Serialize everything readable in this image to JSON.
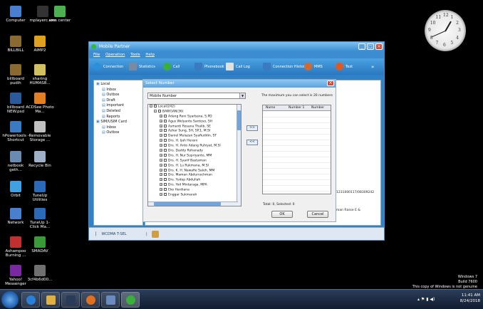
{
  "desktop_icons": [
    {
      "label": "Computer",
      "color": "#4a7fd0"
    },
    {
      "label": "mplayerc.exe",
      "color": "#333333"
    },
    {
      "label": "sms center",
      "color": "#4caf50"
    },
    {
      "label": "BILLBILL",
      "color": "#8a6a30"
    },
    {
      "label": "AIMP2",
      "color": "#e0a020"
    },
    {
      "label": "billboard pudih",
      "color": "#8a6a30"
    },
    {
      "label": "sharing HUMAS8...",
      "color": "#d0c060"
    },
    {
      "label": "billboard NEW.psd",
      "color": "#2a5a9a"
    },
    {
      "label": "ACDSee Photo Ma...",
      "color": "#e08020"
    },
    {
      "label": "hPowertools - Shortcut",
      "color": "#3a7ac0"
    },
    {
      "label": "Removable Storage ...",
      "color": "#c0c0c0"
    },
    {
      "label": "netbook geth...",
      "color": "#6a8ab0"
    },
    {
      "label": "Recycle Bin",
      "color": "#a0b0c8"
    },
    {
      "label": "Orbit",
      "color": "#40a0e0"
    },
    {
      "label": "TuneUp Utilities",
      "color": "#2a6ab8"
    },
    {
      "label": "Network",
      "color": "#4a7fd0"
    },
    {
      "label": "TuneUp 1-Click Ma...",
      "color": "#2a6ab8"
    },
    {
      "label": "Ashampoo Burning ...",
      "color": "#c03030"
    },
    {
      "label": "SMADAV",
      "color": "#3a9a3a"
    },
    {
      "label": "Yahoo! Messenger",
      "color": "#7a2aa0"
    },
    {
      "label": "3cf4b6d00...",
      "color": "#707070"
    }
  ],
  "clock": {
    "numbers": [
      "12",
      "1",
      "2",
      "3",
      "4",
      "5",
      "6",
      "7",
      "8",
      "9",
      "10",
      "11"
    ]
  },
  "app": {
    "title": "Mobile Partner",
    "menu": [
      "File",
      "Operation",
      "Tools",
      "Help"
    ],
    "toolbar": [
      {
        "label": "Connection",
        "color": "#2a90d8"
      },
      {
        "label": "Statistics",
        "color": "#7a8aa0"
      },
      {
        "label": "Call",
        "color": "#3ab03a"
      },
      {
        "label": "Phonebook",
        "color": "#3a7ac0"
      },
      {
        "label": "Call Log",
        "color": "#e0e0e0"
      },
      {
        "label": "Connection History",
        "color": "#3a7ac0"
      },
      {
        "label": "MMS",
        "color": "#d06a30"
      },
      {
        "label": "Text",
        "color": "#e05a20"
      }
    ],
    "toolbar_more": "»",
    "left_tree": {
      "root": "Local",
      "items": [
        "Inbox",
        "Outbox",
        "Draft",
        "Important",
        "Deleted",
        "Reports"
      ],
      "root2": "SIM/USIM Card",
      "items2": [
        "Inbox",
        "Outbox"
      ]
    },
    "right_text_1": "1231000117/08309242",
    "right_text_2": "man Rasse E &",
    "status": "WCDMA  T-SEL"
  },
  "dialog": {
    "title": "Select Number",
    "combo_value": "Mobile Number",
    "max_label": "The maximum you can select is 20 numbers",
    "root_label": "Local(242)",
    "group_label": "BAWGAN(36)",
    "contacts": [
      "Adang Roni Syarbana, S.PD",
      "Agus Welyanto Santoso, SH",
      "Asmanti Rosana Thalib, SE",
      "Azhar Sung, SH, SP.1, M.SI",
      "Daniel Mulazan Syafiuddin, ST",
      "Drs. H. Ijah Herani",
      "Drs. H. Anto Adang Ruhiyat, M.SI",
      "Drs. Daddy Rohanady",
      "Drs. H. Nur Supriyanto, MM",
      "Drs. H. Syarif Bastaman",
      "Drs. H. Lu Rukmana, M.SI",
      "Drs. K. H. Nawafie Saleh, MM",
      "Drs. Maman Abdurrachman",
      "Drs. Yudop Abdullah",
      "Drs. Yod Mintaraga, MPA",
      "Eko Hardiana",
      "Enggar Sukmarah"
    ],
    "add_button": ">>",
    "remove_button": "<<",
    "columns": [
      "Name",
      "Number 1",
      "Number"
    ],
    "total": "Total: 0, Selected: 0",
    "ok": "OK",
    "cancel": "Cancel"
  },
  "watermark": {
    "line1": "Windows 7",
    "line2": "Build 7600",
    "line3": "This copy of Windows is not genuine"
  },
  "tray": {
    "time": "11:41 AM",
    "date": "8/24/2018"
  }
}
